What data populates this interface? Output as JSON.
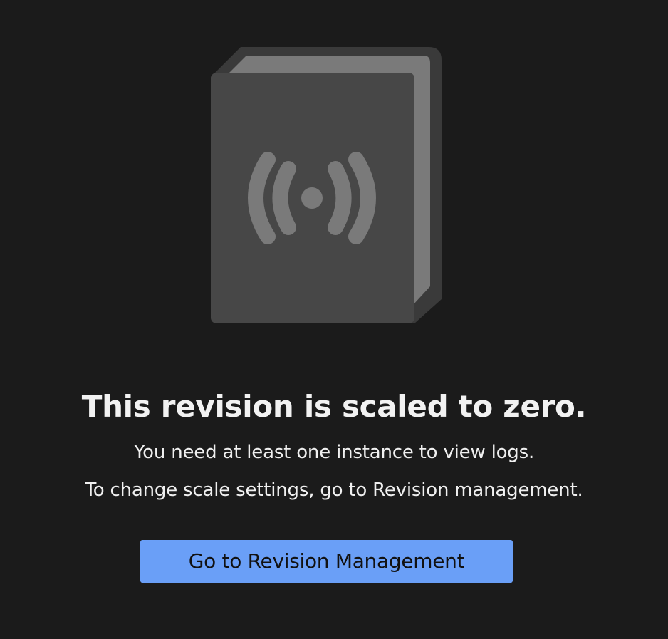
{
  "empty_state": {
    "illustration_icon": "book-broadcast-icon",
    "title": "This revision is scaled to zero.",
    "description_line_1": "You need at least one instance to view logs.",
    "description_line_2": "To change scale settings, go to Revision management.",
    "action_button_label": "Go to Revision Management"
  },
  "colors": {
    "background": "#1b1b1b",
    "button_background": "#6a9ff7",
    "button_text": "#111111",
    "text": "#f2f2f2"
  }
}
